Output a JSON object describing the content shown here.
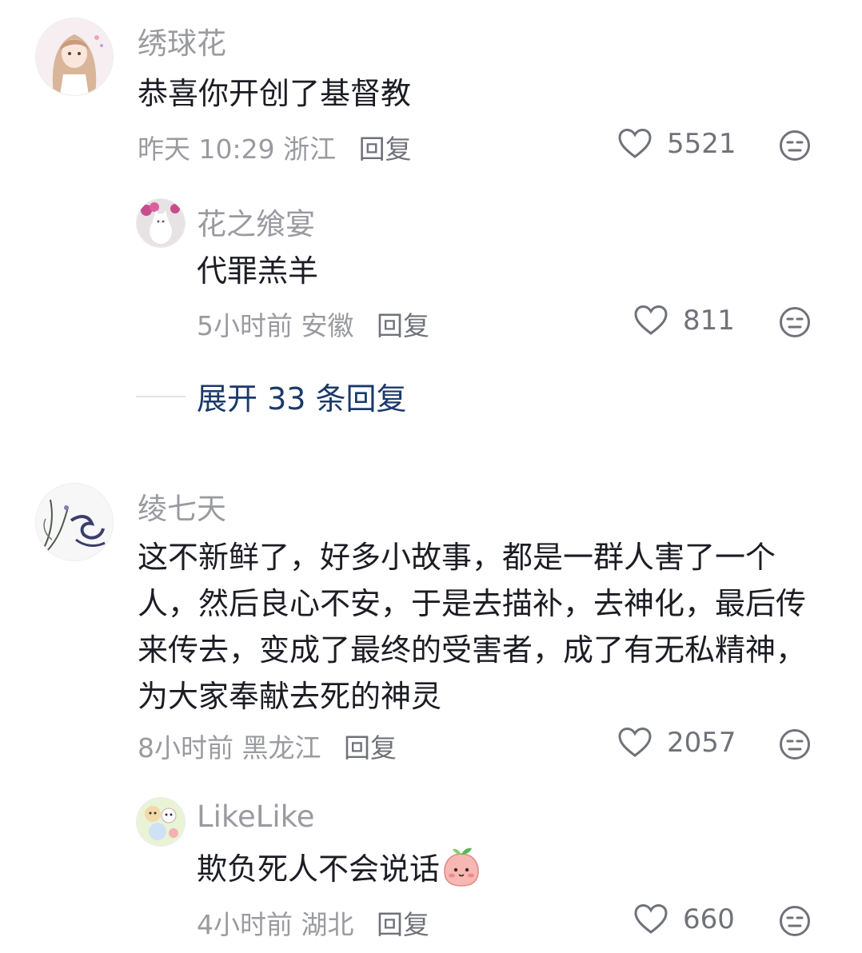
{
  "comments": [
    {
      "avatar_icon": "anime-girl-avatar-icon",
      "username": "绣球花",
      "text": "恭喜你开创了基督教",
      "time": "昨天 10:29",
      "location": "浙江",
      "reply_label": "回复",
      "likes": "5521"
    },
    {
      "avatar_icon": "white-cat-flowers-avatar-icon",
      "username": "花之飨宴",
      "text": "代罪羔羊",
      "time": "5小时前",
      "location": "安徽",
      "reply_label": "回复",
      "likes": "811"
    },
    {
      "avatar_icon": "calligraphy-orchid-avatar-icon",
      "username": "绫七天",
      "text": "这不新鲜了，好多小故事，都是一群人害了一个人，然后良心不安，于是去描补，去神化，最后传来传去，变成了最终的受害者，成了有无私精神，为大家奉献去死的神灵",
      "time": "8小时前",
      "location": "黑龙江",
      "reply_label": "回复",
      "likes": "2057"
    },
    {
      "avatar_icon": "cartoon-animals-avatar-icon",
      "username": "LikeLike",
      "text": "欺负死人不会说话",
      "emoji": "peach-blush-emoji",
      "time": "4小时前",
      "location": "湖北",
      "reply_label": "回复",
      "likes": "660"
    }
  ],
  "expand_replies": "展开 33 条回复",
  "colors": {
    "username": "#9a9ba0",
    "body_text": "#1c1d24",
    "expand_link": "#1b3a6b"
  }
}
